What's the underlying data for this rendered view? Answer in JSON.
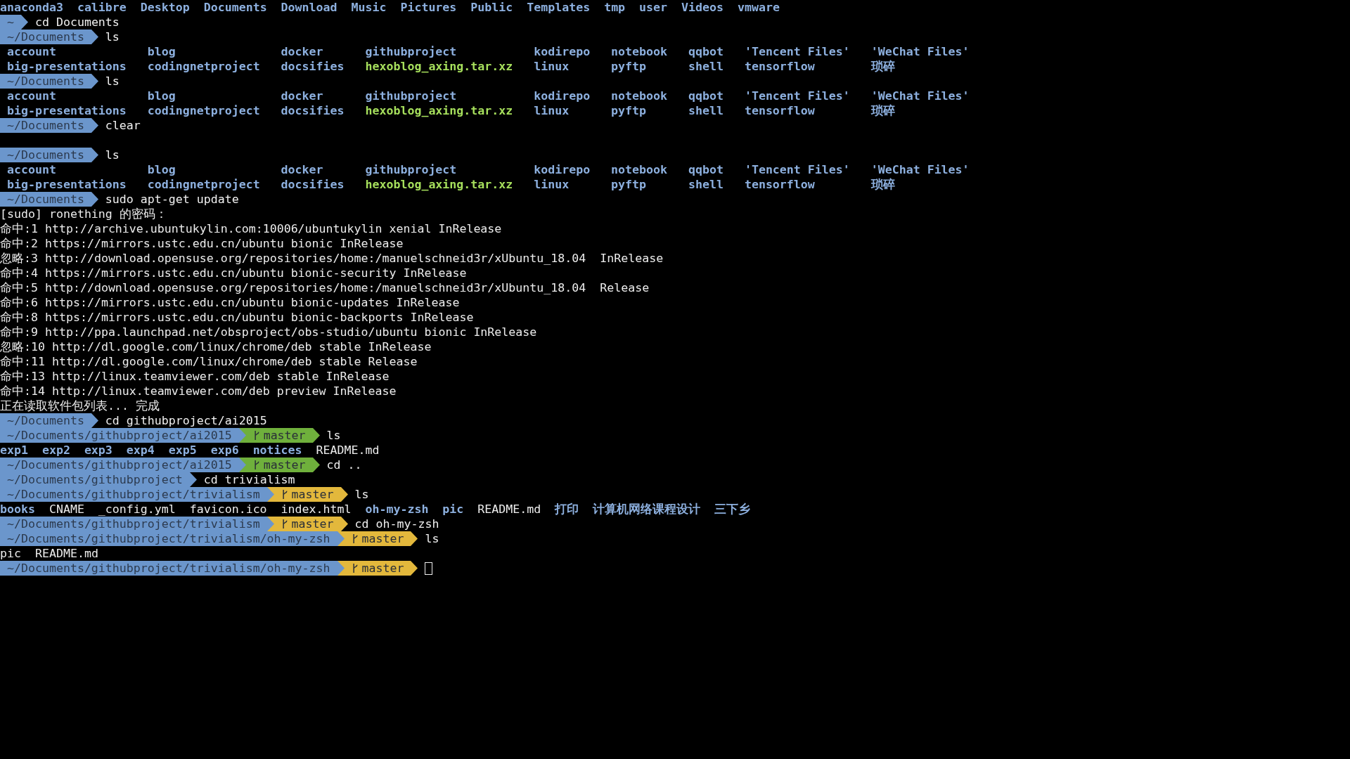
{
  "terminal": {
    "lines": [
      {
        "kind": "listing",
        "entries": [
          {
            "name": "anaconda3",
            "kind": "dir"
          },
          {
            "name": "calibre",
            "kind": "dir"
          },
          {
            "name": "Desktop",
            "kind": "dir"
          },
          {
            "name": "Documents",
            "kind": "dir"
          },
          {
            "name": "Download",
            "kind": "dir"
          },
          {
            "name": "Music",
            "kind": "dir"
          },
          {
            "name": "Pictures",
            "kind": "dir"
          },
          {
            "name": "Public",
            "kind": "dir"
          },
          {
            "name": "Templates",
            "kind": "dir"
          },
          {
            "name": "tmp",
            "kind": "dir"
          },
          {
            "name": "user",
            "kind": "dir"
          },
          {
            "name": "Videos",
            "kind": "dir"
          },
          {
            "name": "vmware",
            "kind": "dir"
          }
        ]
      },
      {
        "kind": "prompt",
        "path": "~",
        "command": "cd Documents"
      },
      {
        "kind": "prompt",
        "path": "~/Documents",
        "command": "ls"
      },
      {
        "kind": "grid",
        "rows": [
          [
            {
              "name": "account",
              "kind": "dir"
            },
            {
              "name": "blog",
              "kind": "dir"
            },
            {
              "name": "docker",
              "kind": "dir"
            },
            {
              "name": "githubproject",
              "kind": "dir"
            },
            {
              "name": "kodirepo",
              "kind": "dir"
            },
            {
              "name": "notebook",
              "kind": "dir"
            },
            {
              "name": "qqbot",
              "kind": "dir"
            },
            {
              "name": "'Tencent Files'",
              "kind": "dir"
            },
            {
              "name": "'WeChat Files'",
              "kind": "dir"
            }
          ],
          [
            {
              "name": "big-presentations",
              "kind": "dir"
            },
            {
              "name": "codingnetproject",
              "kind": "dir"
            },
            {
              "name": "docsifies",
              "kind": "dir"
            },
            {
              "name": "hexoblog_axing.tar.xz",
              "kind": "archive"
            },
            {
              "name": "linux",
              "kind": "dir"
            },
            {
              "name": "pyftp",
              "kind": "dir"
            },
            {
              "name": "shell",
              "kind": "dir"
            },
            {
              "name": "tensorflow",
              "kind": "dir"
            },
            {
              "name": "琐碎",
              "kind": "dir"
            }
          ]
        ]
      },
      {
        "kind": "prompt",
        "path": "~/Documents",
        "command": "ls"
      },
      {
        "kind": "grid",
        "rows": [
          [
            {
              "name": "account",
              "kind": "dir"
            },
            {
              "name": "blog",
              "kind": "dir"
            },
            {
              "name": "docker",
              "kind": "dir"
            },
            {
              "name": "githubproject",
              "kind": "dir"
            },
            {
              "name": "kodirepo",
              "kind": "dir"
            },
            {
              "name": "notebook",
              "kind": "dir"
            },
            {
              "name": "qqbot",
              "kind": "dir"
            },
            {
              "name": "'Tencent Files'",
              "kind": "dir"
            },
            {
              "name": "'WeChat Files'",
              "kind": "dir"
            }
          ],
          [
            {
              "name": "big-presentations",
              "kind": "dir"
            },
            {
              "name": "codingnetproject",
              "kind": "dir"
            },
            {
              "name": "docsifies",
              "kind": "dir"
            },
            {
              "name": "hexoblog_axing.tar.xz",
              "kind": "archive"
            },
            {
              "name": "linux",
              "kind": "dir"
            },
            {
              "name": "pyftp",
              "kind": "dir"
            },
            {
              "name": "shell",
              "kind": "dir"
            },
            {
              "name": "tensorflow",
              "kind": "dir"
            },
            {
              "name": "琐碎",
              "kind": "dir"
            }
          ]
        ]
      },
      {
        "kind": "prompt",
        "path": "~/Documents",
        "command": "clear"
      },
      {
        "kind": "blank"
      },
      {
        "kind": "prompt",
        "path": "~/Documents",
        "command": "ls"
      },
      {
        "kind": "grid",
        "rows": [
          [
            {
              "name": "account",
              "kind": "dir"
            },
            {
              "name": "blog",
              "kind": "dir"
            },
            {
              "name": "docker",
              "kind": "dir"
            },
            {
              "name": "githubproject",
              "kind": "dir"
            },
            {
              "name": "kodirepo",
              "kind": "dir"
            },
            {
              "name": "notebook",
              "kind": "dir"
            },
            {
              "name": "qqbot",
              "kind": "dir"
            },
            {
              "name": "'Tencent Files'",
              "kind": "dir"
            },
            {
              "name": "'WeChat Files'",
              "kind": "dir"
            }
          ],
          [
            {
              "name": "big-presentations",
              "kind": "dir"
            },
            {
              "name": "codingnetproject",
              "kind": "dir"
            },
            {
              "name": "docsifies",
              "kind": "dir"
            },
            {
              "name": "hexoblog_axing.tar.xz",
              "kind": "archive"
            },
            {
              "name": "linux",
              "kind": "dir"
            },
            {
              "name": "pyftp",
              "kind": "dir"
            },
            {
              "name": "shell",
              "kind": "dir"
            },
            {
              "name": "tensorflow",
              "kind": "dir"
            },
            {
              "name": "琐碎",
              "kind": "dir"
            }
          ]
        ]
      },
      {
        "kind": "prompt",
        "path": "~/Documents",
        "command": "sudo apt-get update"
      },
      {
        "kind": "text",
        "text": "[sudo] ronething 的密码："
      },
      {
        "kind": "text",
        "text": "命中:1 http://archive.ubuntukylin.com:10006/ubuntukylin xenial InRelease"
      },
      {
        "kind": "text",
        "text": "命中:2 https://mirrors.ustc.edu.cn/ubuntu bionic InRelease"
      },
      {
        "kind": "text",
        "text": "忽略:3 http://download.opensuse.org/repositories/home:/manuelschneid3r/xUbuntu_18.04  InRelease"
      },
      {
        "kind": "text",
        "text": "命中:4 https://mirrors.ustc.edu.cn/ubuntu bionic-security InRelease"
      },
      {
        "kind": "text",
        "text": "命中:5 http://download.opensuse.org/repositories/home:/manuelschneid3r/xUbuntu_18.04  Release"
      },
      {
        "kind": "text",
        "text": "命中:6 https://mirrors.ustc.edu.cn/ubuntu bionic-updates InRelease"
      },
      {
        "kind": "text",
        "text": "命中:8 https://mirrors.ustc.edu.cn/ubuntu bionic-backports InRelease"
      },
      {
        "kind": "text",
        "text": "命中:9 http://ppa.launchpad.net/obsproject/obs-studio/ubuntu bionic InRelease"
      },
      {
        "kind": "text",
        "text": "忽略:10 http://dl.google.com/linux/chrome/deb stable InRelease"
      },
      {
        "kind": "text",
        "text": "命中:11 http://dl.google.com/linux/chrome/deb stable Release"
      },
      {
        "kind": "text",
        "text": "命中:13 http://linux.teamviewer.com/deb stable InRelease"
      },
      {
        "kind": "text",
        "text": "命中:14 http://linux.teamviewer.com/deb preview InRelease"
      },
      {
        "kind": "text",
        "text": "正在读取软件包列表... 完成"
      },
      {
        "kind": "prompt",
        "path": "~/Documents",
        "command": "cd githubproject/ai2015"
      },
      {
        "kind": "prompt",
        "path": "~/Documents/githubproject/ai2015",
        "git": {
          "branch": "master",
          "kind": "clean"
        },
        "command": "ls"
      },
      {
        "kind": "listing",
        "entries": [
          {
            "name": "exp1",
            "kind": "dir"
          },
          {
            "name": "exp2",
            "kind": "dir"
          },
          {
            "name": "exp3",
            "kind": "dir"
          },
          {
            "name": "exp4",
            "kind": "dir"
          },
          {
            "name": "exp5",
            "kind": "dir"
          },
          {
            "name": "exp6",
            "kind": "dir"
          },
          {
            "name": "notices",
            "kind": "dir"
          },
          {
            "name": "README.md",
            "kind": "file"
          }
        ]
      },
      {
        "kind": "prompt",
        "path": "~/Documents/githubproject/ai2015",
        "git": {
          "branch": "master",
          "kind": "clean"
        },
        "command": "cd .."
      },
      {
        "kind": "prompt",
        "path": "~/Documents/githubproject",
        "command": "cd trivialism"
      },
      {
        "kind": "prompt",
        "path": "~/Documents/githubproject/trivialism",
        "git": {
          "branch": "master",
          "kind": "dirty"
        },
        "command": "ls"
      },
      {
        "kind": "listing",
        "entries": [
          {
            "name": "books",
            "kind": "dir"
          },
          {
            "name": "CNAME",
            "kind": "file"
          },
          {
            "name": "_config.yml",
            "kind": "file"
          },
          {
            "name": "favicon.ico",
            "kind": "file"
          },
          {
            "name": "index.html",
            "kind": "file"
          },
          {
            "name": "oh-my-zsh",
            "kind": "dir"
          },
          {
            "name": "pic",
            "kind": "dir"
          },
          {
            "name": "README.md",
            "kind": "file"
          },
          {
            "name": "打印",
            "kind": "dir"
          },
          {
            "name": "计算机网络课程设计",
            "kind": "dir"
          },
          {
            "name": "三下乡",
            "kind": "dir"
          }
        ]
      },
      {
        "kind": "prompt",
        "path": "~/Documents/githubproject/trivialism",
        "git": {
          "branch": "master",
          "kind": "dirty"
        },
        "command": "cd oh-my-zsh"
      },
      {
        "kind": "prompt",
        "path": "~/Documents/githubproject/trivialism/oh-my-zsh",
        "git": {
          "branch": "master",
          "kind": "dirty"
        },
        "command": "ls"
      },
      {
        "kind": "listing",
        "entries": [
          {
            "name": "pic",
            "kind": "file"
          },
          {
            "name": "README.md",
            "kind": "file"
          }
        ]
      },
      {
        "kind": "prompt",
        "path": "~/Documents/githubproject/trivialism/oh-my-zsh",
        "git": {
          "branch": "master",
          "kind": "dirty"
        },
        "cursor": true
      }
    ]
  }
}
